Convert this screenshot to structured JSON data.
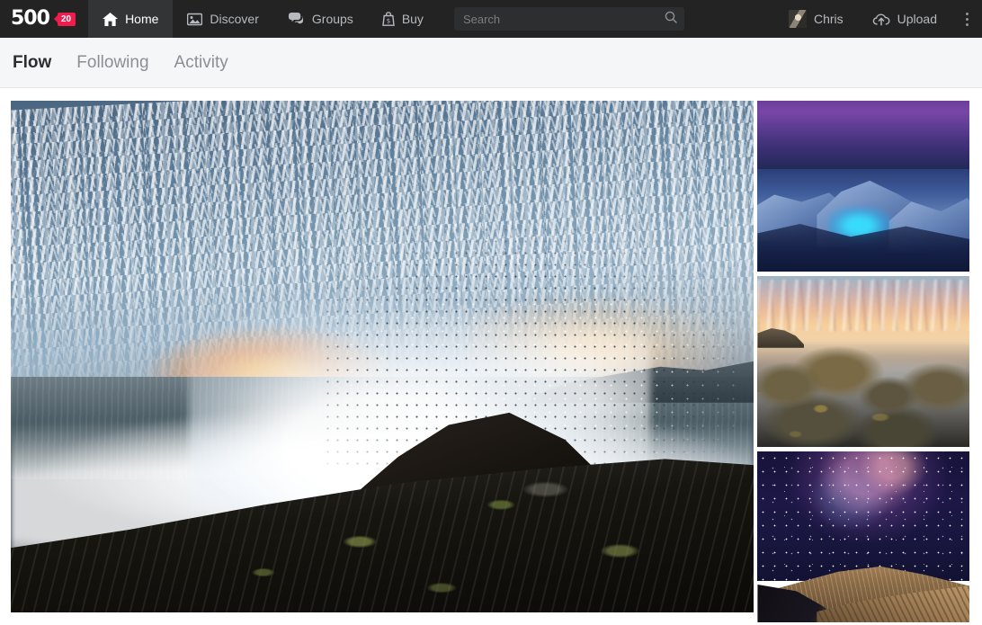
{
  "navbar": {
    "logo": {
      "text": "500",
      "badge": "20",
      "badge_color": "#ee1d4e",
      "icon": "500px-logo"
    },
    "items": [
      {
        "label": "Home",
        "icon": "home-icon",
        "active": true
      },
      {
        "label": "Discover",
        "icon": "image-icon",
        "active": false
      },
      {
        "label": "Groups",
        "icon": "speech-bubbles-icon",
        "active": false
      },
      {
        "label": "Buy",
        "icon": "shopping-bag-dollar-icon",
        "active": false
      }
    ],
    "search": {
      "value": "",
      "placeholder": "Search",
      "icon": "search-icon"
    },
    "user": {
      "name": "Chris",
      "avatar": "user-avatar"
    },
    "upload": {
      "label": "Upload",
      "icon": "upload-cloud-icon"
    },
    "more": {
      "icon": "kebab-menu-icon"
    },
    "background_color": "#232323",
    "active_tab_color": "#333436"
  },
  "tabbar": {
    "tabs": [
      {
        "label": "Flow",
        "active": true
      },
      {
        "label": "Following",
        "active": false
      },
      {
        "label": "Activity",
        "active": false
      }
    ],
    "background_color": "#f5f6f7"
  },
  "content": {
    "hero": {
      "name": "hero-photo",
      "description": "Ocean wave crashing onto dark mossy rocks at sunset under mackerel clouds"
    },
    "thumbnails": [
      {
        "name": "thumbnail-photo-1",
        "description": "Blue ice formations glowing under a purple twilight sky"
      },
      {
        "name": "thumbnail-photo-2",
        "description": "Long exposure seascape with rocks and golden sunset sky"
      },
      {
        "name": "thumbnail-photo-3",
        "description": "Milky Way galaxy over desert sand dunes"
      }
    ]
  }
}
